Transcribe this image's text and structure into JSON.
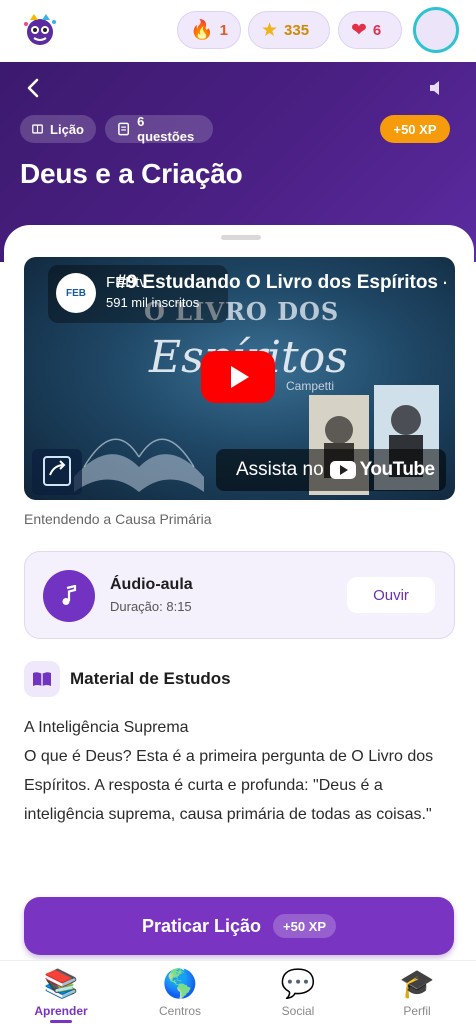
{
  "stats": {
    "streak": "1",
    "stars": "335",
    "lives": "6"
  },
  "header": {
    "chips": {
      "lesson": "Lição",
      "questions": "6 questões"
    },
    "xp": "+50 XP",
    "title": "Deus e a Criação"
  },
  "video": {
    "channel": "FEBtv",
    "subscribers": "591 mil inscritos",
    "title": "#9 Estudando O Livro dos Espíritos -",
    "watch_label": "Assista no",
    "youtube": "YouTube",
    "caption": "Entendendo a Causa Primária"
  },
  "audio": {
    "title": "Áudio-aula",
    "duration": "Duração: 8:15",
    "button": "Ouvir"
  },
  "material": {
    "heading": "Material de Estudos",
    "subtitle": "A Inteligência Suprema",
    "body": "O que é Deus? Esta é a primeira pergunta de O Livro dos Espíritos. A resposta é curta e profunda: \"Deus é a inteligência suprema, causa primária de todas as coisas.\""
  },
  "practice": {
    "label": "Praticar Lição",
    "xp": "+50 XP"
  },
  "nav": [
    {
      "label": "Aprender",
      "icon": "books-icon"
    },
    {
      "label": "Centros",
      "icon": "globe-icon"
    },
    {
      "label": "Social",
      "icon": "speech-bubble-icon"
    },
    {
      "label": "Perfil",
      "icon": "graduation-cap-icon"
    }
  ],
  "colors": {
    "primary": "#7a34c2",
    "header": "#4b2085",
    "xp": "#f59b0c",
    "avatar_ring": "#2fc3d1"
  }
}
